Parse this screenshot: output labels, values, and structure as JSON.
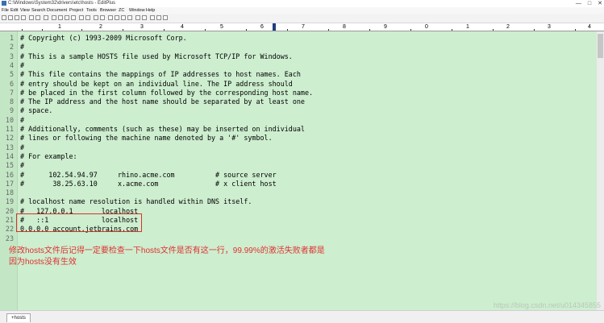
{
  "window": {
    "title": "C:\\Windows\\System32\\drivers\\etc\\hosts - EditPlus",
    "controls": [
      "—",
      "□",
      "✕"
    ]
  },
  "menu": [
    "File",
    "Edit",
    "View",
    "Search",
    "Document",
    "Project",
    "Tools",
    "Browser",
    "ZC",
    "Window",
    "Help"
  ],
  "ruler": {
    "labels": [
      "1",
      "2",
      "3",
      "4",
      "5",
      "6",
      "7",
      "8",
      "9",
      "0",
      "1",
      "2",
      "3",
      "4"
    ]
  },
  "editor": {
    "lines": [
      {
        "n": "1",
        "text": "# Copyright (c) 1993-2009 Microsoft Corp."
      },
      {
        "n": "2",
        "text": "#"
      },
      {
        "n": "3",
        "text": "# This is a sample HOSTS file used by Microsoft TCP/IP for Windows."
      },
      {
        "n": "4",
        "text": "#"
      },
      {
        "n": "5",
        "text": "# This file contains the mappings of IP addresses to host names. Each"
      },
      {
        "n": "6",
        "text": "# entry should be kept on an individual line. The IP address should"
      },
      {
        "n": "7",
        "text": "# be placed in the first column followed by the corresponding host name."
      },
      {
        "n": "8",
        "text": "# The IP address and the host name should be separated by at least one"
      },
      {
        "n": "9",
        "text": "# space."
      },
      {
        "n": "10",
        "text": "#"
      },
      {
        "n": "11",
        "text": "# Additionally, comments (such as these) may be inserted on individual"
      },
      {
        "n": "12",
        "text": "# lines or following the machine name denoted by a '#' symbol."
      },
      {
        "n": "13",
        "text": "#"
      },
      {
        "n": "14",
        "text": "# For example:"
      },
      {
        "n": "15",
        "text": "#"
      },
      {
        "n": "16",
        "text": "#      102.54.94.97     rhino.acme.com          # source server"
      },
      {
        "n": "17",
        "text": "#       38.25.63.10     x.acme.com              # x client host"
      },
      {
        "n": "18",
        "text": ""
      },
      {
        "n": "19",
        "text": "# localhost name resolution is handled within DNS itself."
      },
      {
        "n": "20",
        "text": "#   127.0.0.1       localhost"
      },
      {
        "n": "21",
        "text": "#   ::1             localhost"
      },
      {
        "n": "22",
        "text": "0.0.0.0 account.jetbrains.com"
      },
      {
        "n": "23",
        "text": ""
      }
    ]
  },
  "annotation": {
    "line1": "修改hosts文件后记得一定要检查一下hosts文件是否有这一行，99.99%的激活失败者都是",
    "line2": "因为hosts没有生效"
  },
  "tabs": [
    {
      "label": "hosts"
    }
  ],
  "watermark": "https://blog.csdn.net/u014345855",
  "colors": {
    "editor_bg": "#cdeecf",
    "annotation": "#e03131",
    "highlight_box": "#d9332a"
  }
}
